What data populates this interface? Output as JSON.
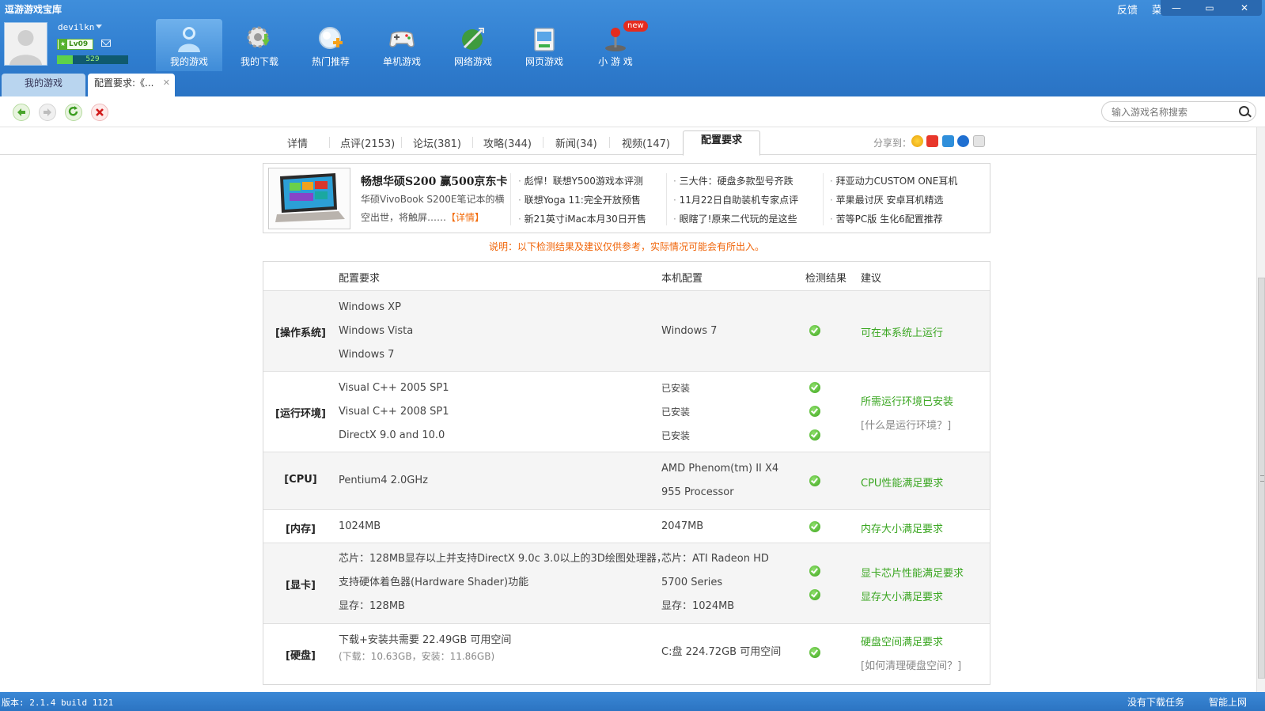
{
  "app": {
    "title": "逗游游戏宝库"
  },
  "user": {
    "name": "devilkn",
    "level": "Lv09",
    "exp": "529",
    "exp_progress": 0.22
  },
  "nav": [
    {
      "label": "我的游戏",
      "icon": "user-game-icon",
      "active": true
    },
    {
      "label": "我的下载",
      "icon": "download-gear-icon"
    },
    {
      "label": "热门推荐",
      "icon": "hot-recommend-icon"
    },
    {
      "label": "单机游戏",
      "icon": "gamepad-icon"
    },
    {
      "label": "网络游戏",
      "icon": "network-game-icon"
    },
    {
      "label": "网页游戏",
      "icon": "web-game-icon"
    },
    {
      "label": "小 游 戏",
      "icon": "joystick-icon",
      "badge": "new"
    }
  ],
  "topright": {
    "feedback": "反馈",
    "menu": "菜单"
  },
  "window_buttons": {
    "minimize": "—",
    "restore": "▭",
    "close": "✕"
  },
  "tabs": [
    {
      "label": "我的游戏"
    },
    {
      "label": "配置要求:《...",
      "close": "✕"
    }
  ],
  "toolbar": {
    "search_placeholder": "输入游戏名称搜索"
  },
  "subtabs": {
    "items": [
      "详情",
      "点评(2153)",
      "论坛(381)",
      "攻略(344)",
      "新闻(34)",
      "视频(147)",
      "配置要求"
    ],
    "active": "配置要求",
    "share_label": "分享到："
  },
  "ad": {
    "title": "畅想华硕S200 赢500京东卡",
    "desc": "华硕VivoBook S200E笔记本的横空出世，将触屏……",
    "link": "【详情】",
    "col1": [
      "彪悍！联想Y500游戏本评测",
      "联想Yoga 11:完全开放预售",
      "新21英寸iMac本月30日开售"
    ],
    "col2": [
      "三大件：硬盘多款型号齐跌",
      "11月22日自助装机专家点评",
      "眼瞎了!原来二代玩的是这些"
    ],
    "col3": [
      "拜亚动力CUSTOM ONE耳机",
      "苹果最讨厌 安卓耳机精选",
      "苦等PC版 生化6配置推荐"
    ]
  },
  "notice": "说明：以下检测结果及建议仅供参考，实际情况可能会有所出入。",
  "config": {
    "headers": {
      "req": "配置要求",
      "local": "本机配置",
      "result": "检测结果",
      "advice": "建议"
    },
    "os": {
      "cat": "[操作系统]",
      "req": [
        "Windows XP",
        "Windows Vista",
        "Windows 7"
      ],
      "local": "Windows 7",
      "advice": "可在本系统上运行"
    },
    "runtime": {
      "cat": "[运行环境]",
      "req": [
        "Visual C++ 2005 SP1",
        "Visual C++ 2008 SP1",
        "DirectX 9.0 and 10.0"
      ],
      "local": [
        "已安装",
        "已安装",
        "已安装"
      ],
      "advice": "所需运行环境已安装",
      "help": "[什么是运行环境？]"
    },
    "cpu": {
      "cat": "[CPU]",
      "req": "Pentium4 2.0GHz",
      "local": [
        "AMD Phenom(tm) II X4",
        "955 Processor"
      ],
      "advice": "CPU性能满足要求"
    },
    "mem": {
      "cat": "[内存]",
      "req": "1024MB",
      "local": "2047MB",
      "advice": "内存大小满足要求"
    },
    "gpu": {
      "cat": "[显卡]",
      "req": [
        "芯片：128MB显存以上并支持DirectX 9.0c 3.0以上的3D绘图处理器，",
        "支持硬体着色器(Hardware Shader)功能",
        "显存：128MB"
      ],
      "local": [
        "芯片：ATI Radeon HD",
        "5700 Series",
        "显存：1024MB"
      ],
      "advice": [
        "显卡芯片性能满足要求",
        "显存大小满足要求"
      ]
    },
    "disk": {
      "cat": "[硬盘]",
      "req": "下载+安装共需要 22.49GB 可用空间",
      "req_sub": "(下载：10.63GB，安装：11.86GB)",
      "local": "C:盘 224.72GB 可用空间",
      "advice": "硬盘空间满足要求",
      "help": "[如何清理硬盘空间？]"
    }
  },
  "status": {
    "version": "版本: 2.1.4 build 1121",
    "download": "没有下载任务",
    "smart": "智能上网"
  }
}
